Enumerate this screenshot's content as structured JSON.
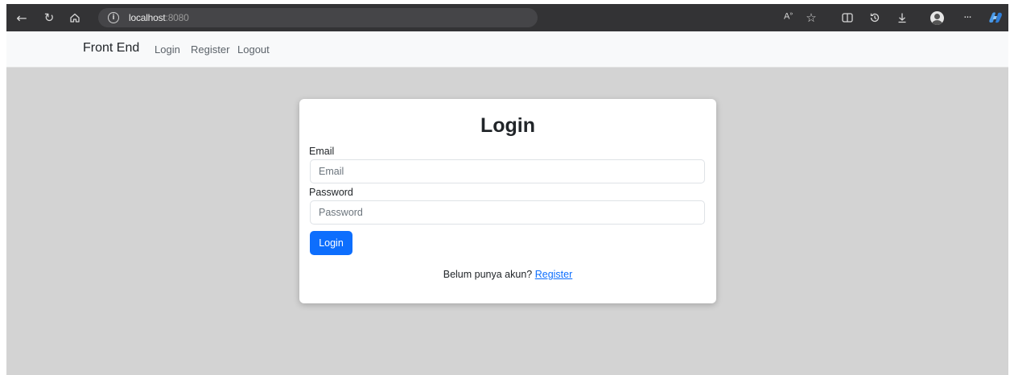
{
  "browser": {
    "url_host": "localhost",
    "url_port": ":8080",
    "toolbar_icons": [
      "back-arrow-icon",
      "refresh-icon",
      "home-icon",
      "site-info-icon",
      "read-aloud-icon",
      "favorite-star-icon",
      "split-screen-icon",
      "history-icon",
      "download-icon",
      "profile-icon",
      "more-icon",
      "copilot-icon"
    ],
    "read_aloud_label": "A",
    "read_aloud_sup": "»"
  },
  "navbar": {
    "brand": "Front End",
    "links": [
      "Login",
      "Register",
      "Logout"
    ]
  },
  "login_card": {
    "title": "Login",
    "email_label": "Email",
    "email_placeholder": "Email",
    "password_label": "Password",
    "password_placeholder": "Password",
    "submit_label": "Login",
    "register_prompt": "Belum punya akun?",
    "register_link": "Register"
  },
  "colors": {
    "page_background": "#d3d3d3",
    "primary": "#0d6efd",
    "navbar_background": "#f8f9fa",
    "browser_toolbar": "#333335"
  }
}
